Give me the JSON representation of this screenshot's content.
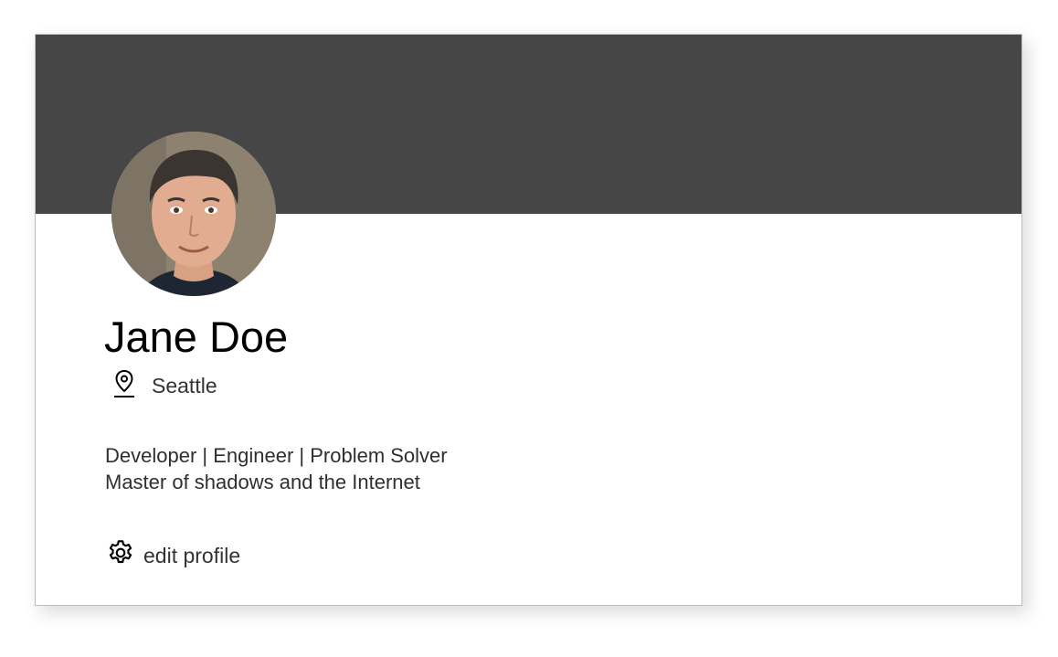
{
  "profile": {
    "name": "Jane Doe",
    "location": "Seattle",
    "bio_line_1": "Developer | Engineer | Problem Solver",
    "bio_line_2": "Master of shadows and the Internet",
    "edit_label": "edit profile"
  },
  "icons": {
    "location": "map-pin-icon",
    "edit": "gear-icon"
  },
  "colors": {
    "banner": "#464646",
    "card_border": "#bdbdbd",
    "name_text": "#000000",
    "body_text": "#333333"
  }
}
